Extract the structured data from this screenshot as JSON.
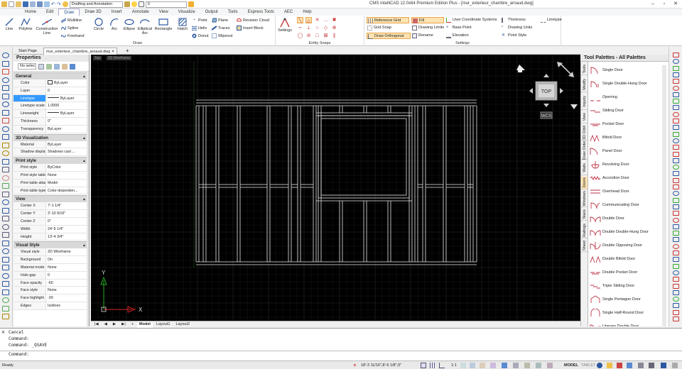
{
  "title_bar": {
    "window_title": "CMS IntelliCAD 12.0x64 Premium Edition Plus - [mur_exterieur_chambre_arnaud.dwg]",
    "workspace": "Drafting and Annotation",
    "layer": "0"
  },
  "menu": [
    "Home",
    "Edit",
    "Draw",
    "Draw 3D",
    "Insert",
    "Annotate",
    "View",
    "Visualize",
    "Output",
    "Tools",
    "Express Tools",
    "AEC",
    "Help"
  ],
  "ribbon": {
    "draw": {
      "group_label": "Draw",
      "line": "Line",
      "polyline": "Polyline",
      "construction_line": "Construction",
      "construction_line_2": "Line",
      "multiline": "Multiline",
      "spline": "Spline",
      "freehand": "Freehand",
      "circle": "Circle",
      "arc": "Arc",
      "ellipse": "Ellipse",
      "elliptical_arc": "Elliptical",
      "elliptical_arc_2": "Arc",
      "rectangle": "Rectangle",
      "hatch": "Hatch",
      "point": "Point",
      "helix": "Helix",
      "donut": "Donut",
      "plane": "Plane",
      "traces": "Traces",
      "wipeout": "Wipeout",
      "revision_cloud": "Revision Cloud",
      "insert_block": "Insert Block"
    },
    "entity_snaps": {
      "group_label": "Entity Snaps",
      "settings": "Settings"
    },
    "settings": {
      "group_label": "Settings",
      "reference_grid": "Reference Grid",
      "grid_snap": "Grid Snap",
      "draw_orthogonal": "Draw Orthogonal",
      "fill": "Fill",
      "drawing_limits": "Drawing Limits",
      "rename": "Rename",
      "user_coordinate_systems": "User Coordinate Systems",
      "base_point": "Base Point",
      "elevation": "Elevation",
      "thickness": "Thickness",
      "drawing_units": "Drawing Units",
      "point_style": "Point Style",
      "linetype": "Linetype"
    }
  },
  "doc_tabs": [
    "Start Page",
    "mur_exterieur_chambre_arnaud.dwg"
  ],
  "properties": {
    "title": "Properties",
    "selection": "No selec",
    "sections": [
      {
        "name": "General",
        "rows": [
          {
            "k": "Color",
            "v": "ByLayer"
          },
          {
            "k": "Layer",
            "v": "0"
          },
          {
            "k": "Linetype",
            "v": "ByLayer"
          },
          {
            "k": "Linetype scale",
            "v": "1.0000"
          },
          {
            "k": "Lineweight",
            "v": "ByLayer"
          },
          {
            "k": "Thickness",
            "v": "0\""
          },
          {
            "k": "Transparency",
            "v": "ByLayer"
          }
        ]
      },
      {
        "name": "3D Visualization",
        "rows": [
          {
            "k": "Material",
            "v": "ByLayer"
          },
          {
            "k": "Shadow display",
            "v": "Shadows cast ..."
          }
        ]
      },
      {
        "name": "Print style",
        "rows": [
          {
            "k": "Print style",
            "v": "ByColor"
          },
          {
            "k": "Print style table",
            "v": "None"
          },
          {
            "k": "Print table attac...",
            "v": "Model"
          },
          {
            "k": "Print table type",
            "v": "Color-dependen..."
          }
        ]
      },
      {
        "name": "View",
        "rows": [
          {
            "k": "Center X",
            "v": "7'-1 1/4\""
          },
          {
            "k": "Center Y",
            "v": "3'-10 9/16\""
          },
          {
            "k": "Center Z",
            "v": "0\""
          },
          {
            "k": "Width",
            "v": "24'-5 1/4\""
          },
          {
            "k": "Height",
            "v": "13'-4 3/4\""
          }
        ]
      },
      {
        "name": "Visual Style",
        "rows": [
          {
            "k": "Visual style",
            "v": "2D Wireframe"
          },
          {
            "k": "Background",
            "v": "On"
          },
          {
            "k": "Material mode",
            "v": "None"
          },
          {
            "k": "Halo gap",
            "v": "0"
          },
          {
            "k": "Face opacity",
            "v": "-60"
          },
          {
            "k": "Face style",
            "v": "None"
          },
          {
            "k": "Face highlight",
            "v": "-30"
          },
          {
            "k": "Edges",
            "v": "Isolines"
          }
        ]
      }
    ]
  },
  "canvas": {
    "view_label": "Top",
    "style_label": "2D Wireframe",
    "viewcube_top": "TOP",
    "viewcube_wcs": "WCS",
    "ucs_x": "X",
    "ucs_y": "Y"
  },
  "layout_tabs": [
    "Model",
    "Layout1",
    "Layout2"
  ],
  "palette": {
    "title": "Tool Palettes - All Palettes",
    "side_tabs": [
      "Tools",
      "Modify",
      "Inquiry",
      "View",
      "3D Orbit",
      "Draw Order",
      "Walls",
      "Doors",
      "Windows",
      "Stairs",
      "Railings",
      "Sheet"
    ],
    "active_tab": "Doors",
    "items": [
      "Single Door",
      "Single Double-Hung Door",
      "Opening",
      "Sliding Door",
      "Pocket Door",
      "Bifold Door",
      "Panel Door",
      "Revolving Door",
      "Accordion Door",
      "Overhead Door",
      "Communicating Door",
      "Double Door",
      "Double Double-Hung Door",
      "Double Opposing Door",
      "Double Bifold Door",
      "Double Pocket Door",
      "Triple Sliding Door",
      "Single Pentagon Door",
      "Single Half-Round Door",
      "Uneven Double Door"
    ]
  },
  "command": {
    "history": [
      "Cancel",
      "Command:",
      "Command: _QSAVE"
    ],
    "prompt": "Command:"
  },
  "status": {
    "ready": "Ready",
    "coords": "18'-3 11/16\",8'-6 1/8\",0\"",
    "scale": "1:1",
    "model": "MODEL",
    "tablet": "TABLET"
  },
  "colors": {
    "accent": "#1a4a8a",
    "snap_on": "#fde3b1",
    "canvas": "#000000",
    "wall": "#e8e8e8"
  }
}
